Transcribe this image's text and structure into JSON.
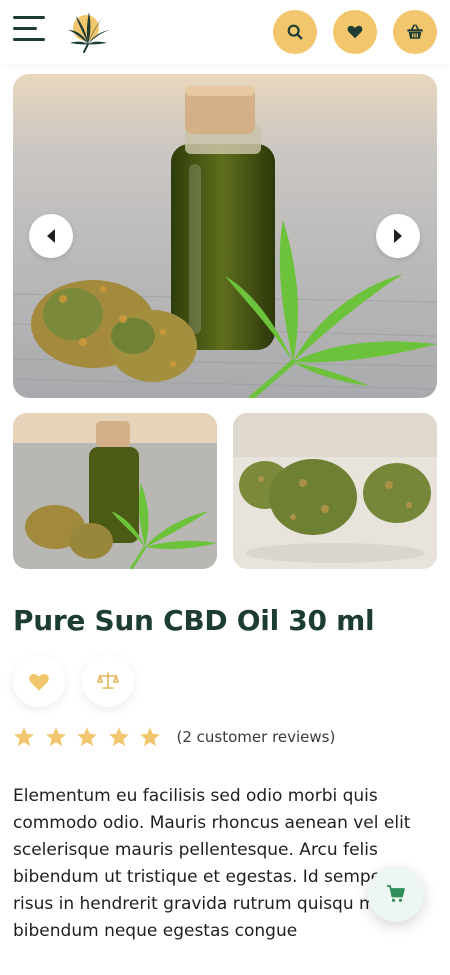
{
  "header": {
    "menu_icon": "hamburger-menu-icon",
    "logo_icon": "cannabis-leaf-logo",
    "buttons": [
      {
        "icon": "search-icon"
      },
      {
        "icon": "heart-icon"
      },
      {
        "icon": "basket-icon"
      }
    ],
    "accent_color": "#f2c66d"
  },
  "gallery": {
    "main_image": "cbd-oil-bottle-photo",
    "prev_icon": "chevron-left-icon",
    "next_icon": "chevron-right-icon",
    "thumbnails": [
      "cbd-oil-bottle-thumb",
      "cannabis-buds-thumb"
    ]
  },
  "product": {
    "title": "Pure Sun CBD Oil 30 ml",
    "actions": [
      {
        "icon": "heart-icon"
      },
      {
        "icon": "compare-scale-icon"
      }
    ],
    "rating": {
      "stars": 5,
      "max": 5,
      "reviews_text": "(2 customer reviews)"
    },
    "description": "Elementum eu facilisis sed odio morbi quis commodo odio. Mauris rhoncus aenean vel elit scelerisque mauris pellentesque. Arcu felis bibendum ut tristique et egestas. Id semper risus in hendrerit gravida rutrum quisqu mi bibendum neque egestas congue"
  },
  "floating_cart": {
    "icon": "cart-icon"
  },
  "colors": {
    "primary_dark": "#1d3c34",
    "star": "#f2c66d",
    "cart_green": "#2f8f5b"
  }
}
